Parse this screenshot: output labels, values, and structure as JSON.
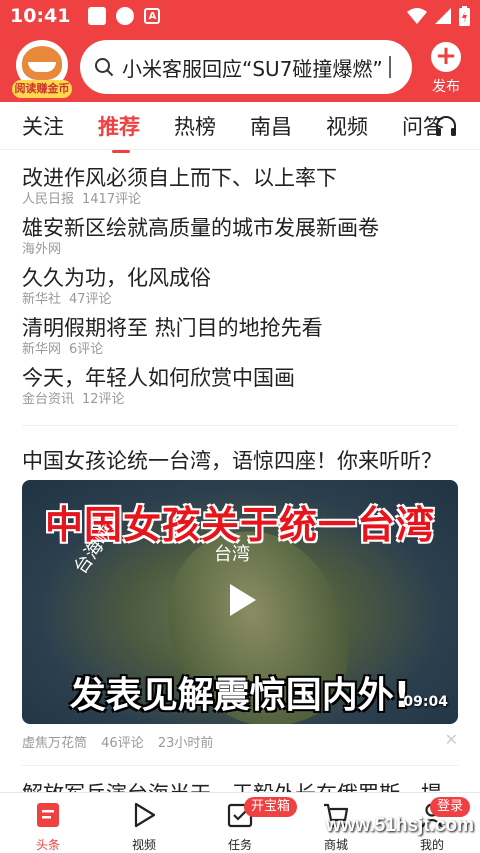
{
  "status_bar": {
    "time": "10:41",
    "notif_letter": "A"
  },
  "header": {
    "avatar_badge": "阅读赚金币",
    "search_text": "小米客服回应“SU7碰撞爆燃”",
    "publish_label": "发布"
  },
  "tabs": [
    "关注",
    "推荐",
    "热榜",
    "南昌",
    "视频",
    "问答"
  ],
  "headlines": [
    {
      "title": "改进作风必须自上而下、以上率下",
      "source": "人民日报",
      "comments": "1417评论"
    },
    {
      "title": "雄安新区绘就高质量的城市发展新画卷",
      "source": "海外网",
      "comments": ""
    },
    {
      "title": "久久为功，化风成俗",
      "source": "新华社",
      "comments": "47评论"
    },
    {
      "title": "清明假期将至 热门目的地抢先看",
      "source": "新华网",
      "comments": "6评论"
    },
    {
      "title": "今天，年轻人如何欣赏中国画",
      "source": "金台资讯",
      "comments": "12评论"
    }
  ],
  "video_article": {
    "title": "中国女孩论统一台湾，语惊四座！你来听听？",
    "caption_top": "中国女孩关于统一台湾",
    "caption_bottom": "发表见解震惊国内外!",
    "place_label": "台湾",
    "strait_label": "台海峡",
    "duration": "09:04",
    "source": "虚焦万花筒",
    "comments": "46评论",
    "time_ago": "23小时前"
  },
  "next_article_title": "解放军兵演台海当天，王毅外长在俄罗斯一提",
  "bottom_nav": [
    {
      "label": "头条",
      "icon": "headline-icon"
    },
    {
      "label": "视频",
      "icon": "play-icon"
    },
    {
      "label": "任务",
      "icon": "task-icon",
      "badge": "开宝箱"
    },
    {
      "label": "商城",
      "icon": "cart-icon"
    },
    {
      "label": "我的",
      "icon": "user-icon",
      "badge": "登录"
    }
  ],
  "watermark": "www.51hsjt.com",
  "colors": {
    "brand": "#f04142"
  }
}
